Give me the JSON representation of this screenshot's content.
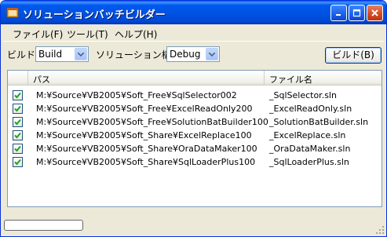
{
  "window": {
    "title": "ソリューションバッチビルダー"
  },
  "menu": [
    {
      "label": "ファイル(F)"
    },
    {
      "label": "ツール(T)"
    },
    {
      "label": "ヘルプ(H)"
    }
  ],
  "toolbar": {
    "build_label": "ビルド",
    "build_combo_value": "Build",
    "config_label": "ソリューション構成",
    "config_combo_value": "Debug",
    "build_button": "ビルド(B)"
  },
  "list": {
    "columns": [
      "パス",
      "ファイル名"
    ],
    "rows": [
      {
        "checked": true,
        "path": "M:¥Source¥VB2005¥Soft_Free¥SqlSelector002",
        "file": "_SqlSelector.sln"
      },
      {
        "checked": true,
        "path": "M:¥Source¥VB2005¥Soft_Free¥ExcelReadOnly200",
        "file": "_ExcelReadOnly.sln"
      },
      {
        "checked": true,
        "path": "M:¥Source¥VB2005¥Soft_Free¥SolutionBatBuilder100",
        "file": "_SolutionBatBuilder.sln"
      },
      {
        "checked": true,
        "path": "M:¥Source¥VB2005¥Soft_Share¥ExcelReplace100",
        "file": "_ExcelReplace.sln"
      },
      {
        "checked": true,
        "path": "M:¥Source¥VB2005¥Soft_Share¥OraDataMaker100",
        "file": "_OraDataMaker.sln"
      },
      {
        "checked": true,
        "path": "M:¥Source¥VB2005¥Soft_Share¥SqlLoaderPlus100",
        "file": "_SqlLoaderPlus.sln"
      }
    ]
  },
  "colors": {
    "titlebar": "#0054e3",
    "checkmark": "#21a121",
    "window_bg": "#ece9d8"
  }
}
